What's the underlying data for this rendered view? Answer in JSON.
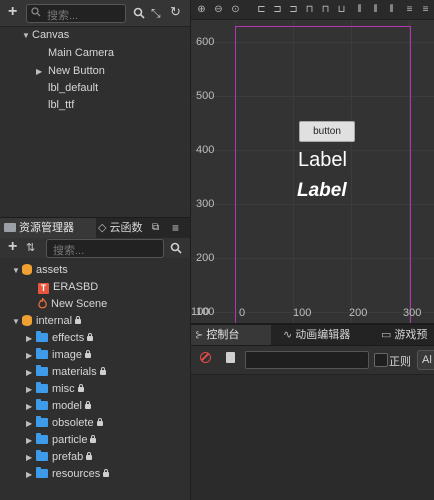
{
  "hierarchy": {
    "search_placeholder": "搜索...",
    "items": [
      {
        "label": "Canvas"
      },
      {
        "label": "Main Camera"
      },
      {
        "label": "New Button"
      },
      {
        "label": "lbl_default"
      },
      {
        "label": "lbl_ttf"
      }
    ]
  },
  "assets_panel": {
    "tabs": [
      {
        "label": "资源管理器"
      },
      {
        "label": "云函数"
      }
    ],
    "search_placeholder": "搜索...",
    "items": [
      {
        "label": "assets"
      },
      {
        "label": "ERASBD"
      },
      {
        "label": "New Scene"
      },
      {
        "label": "internal"
      },
      {
        "label": "effects"
      },
      {
        "label": "image"
      },
      {
        "label": "materials"
      },
      {
        "label": "misc"
      },
      {
        "label": "model"
      },
      {
        "label": "obsolete"
      },
      {
        "label": "particle"
      },
      {
        "label": "prefab"
      },
      {
        "label": "resources"
      }
    ]
  },
  "scene": {
    "y_ticks": [
      "600",
      "500",
      "400",
      "300",
      "200",
      "100"
    ],
    "x_ticks": [
      "100",
      "0",
      "100",
      "200",
      "300"
    ],
    "button_label": "button",
    "label_default": "Label",
    "label_ttf": "Label",
    "frame_color": "#b236b2"
  },
  "console": {
    "tabs": [
      {
        "label": "控制台"
      },
      {
        "label": "动画编辑器"
      },
      {
        "label": "游戏预览"
      }
    ],
    "regex_label": "正则",
    "level_label": "Al"
  }
}
